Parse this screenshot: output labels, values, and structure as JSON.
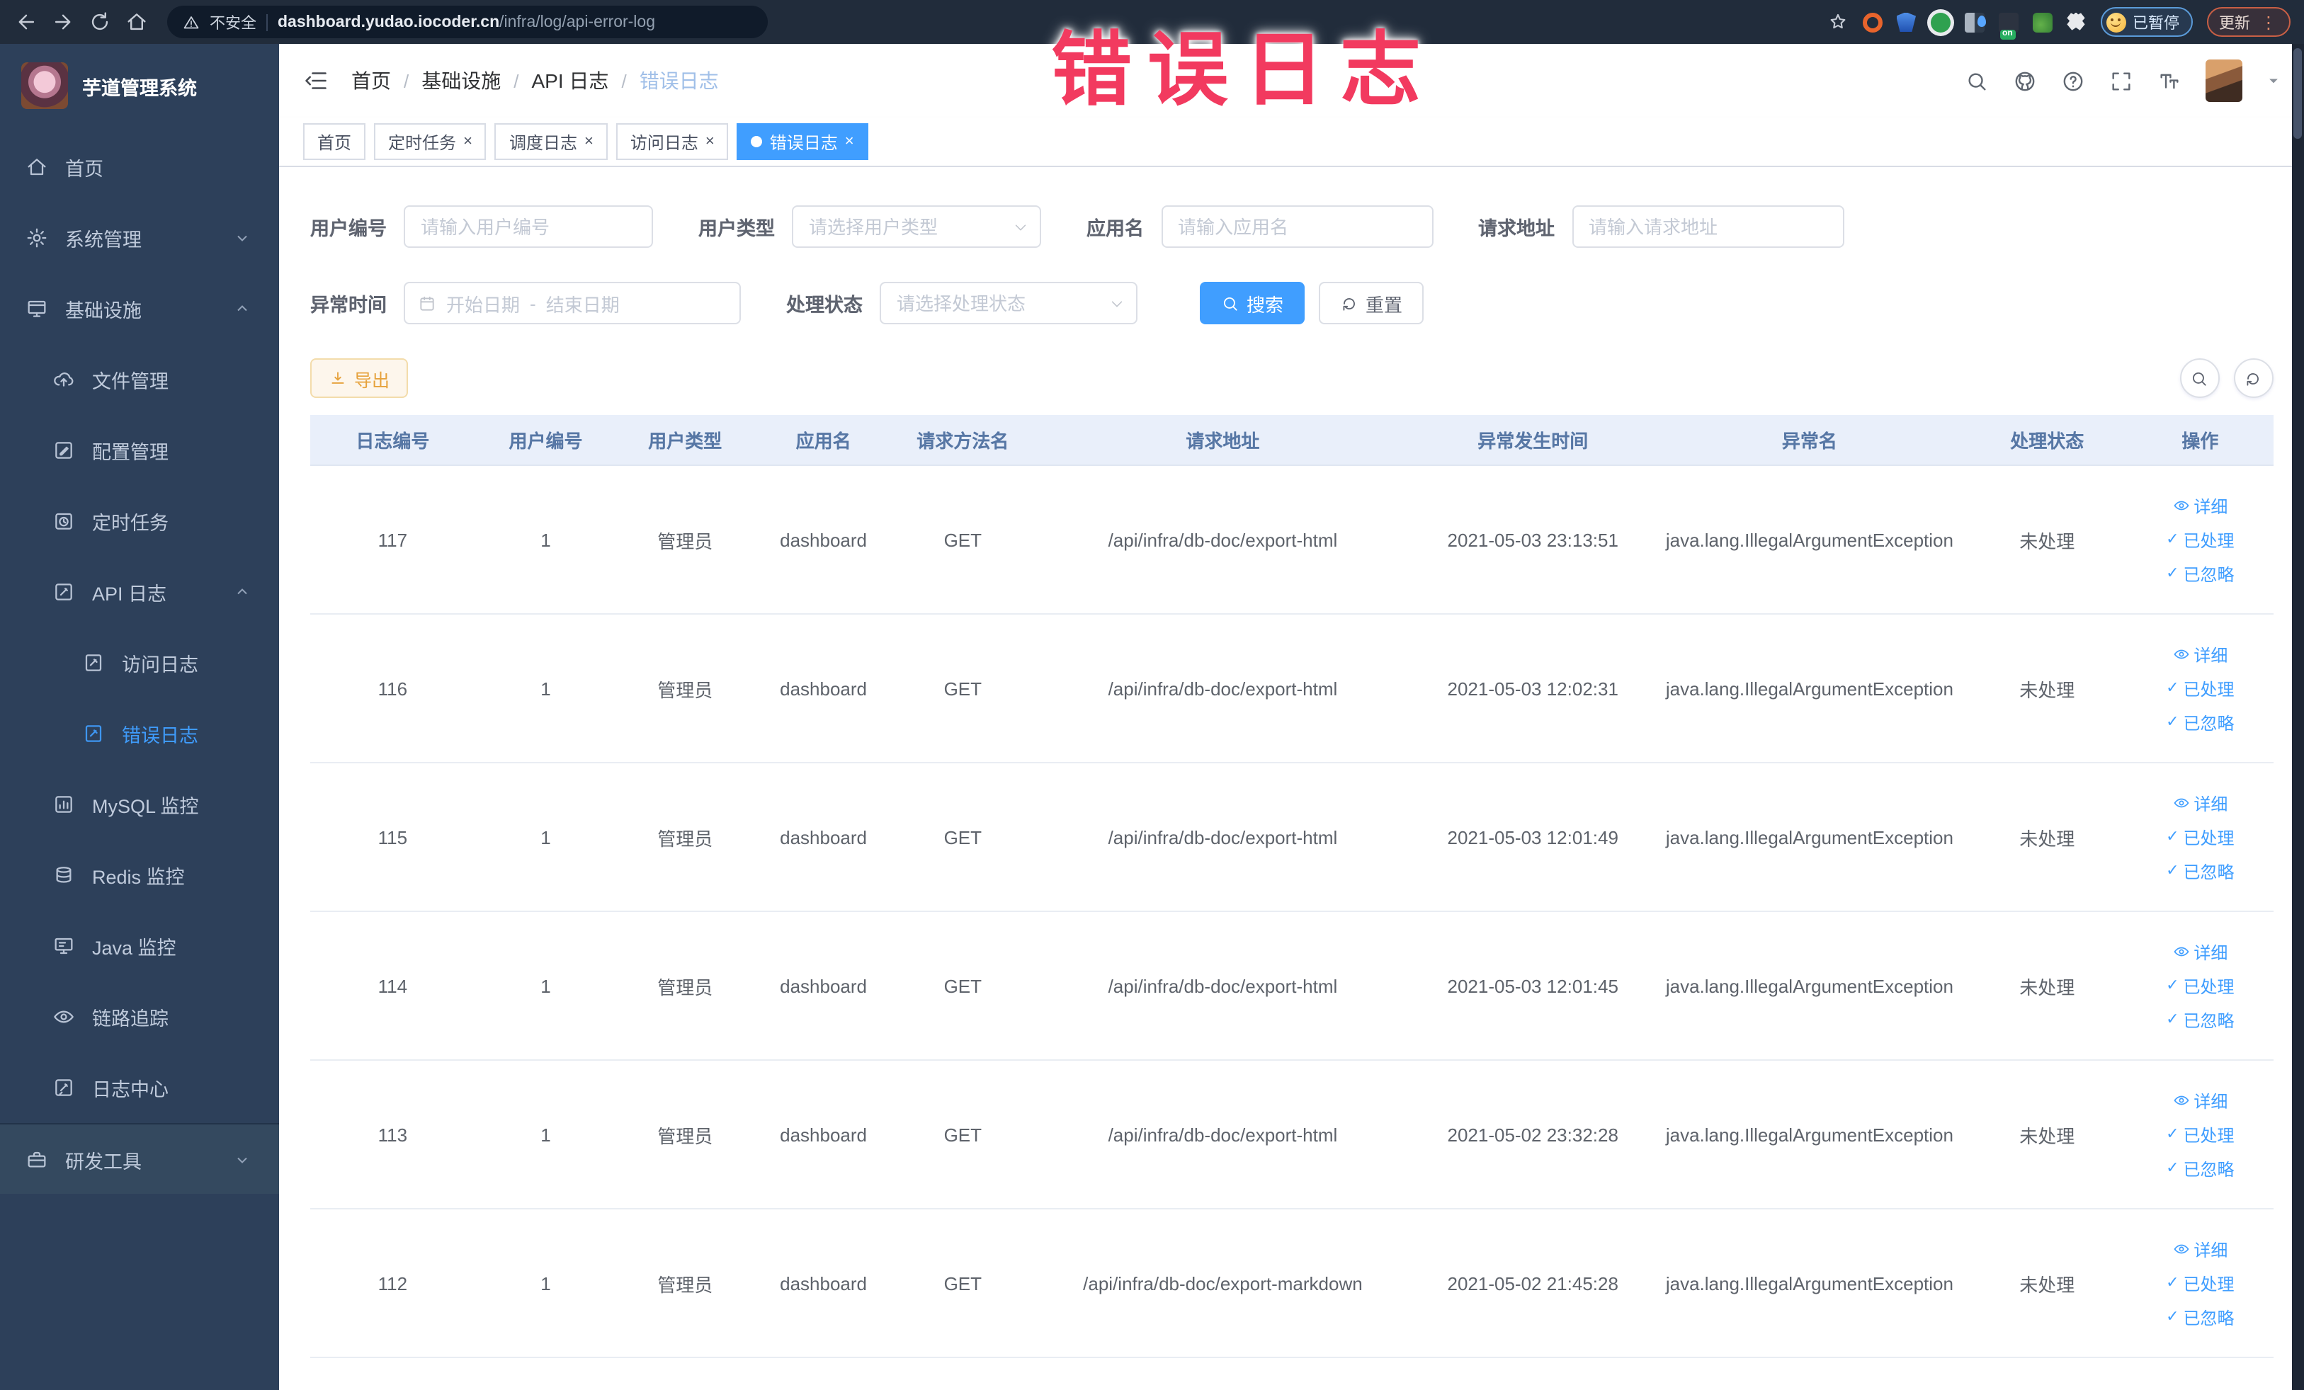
{
  "browser": {
    "security_label": "不安全",
    "url_host": "dashboard.yudao.iocoder.cn",
    "url_path": "/infra/log/api-error-log",
    "nav_icons": [
      "back-arrow",
      "forward-arrow",
      "reload",
      "home"
    ],
    "extension_icons": [
      "bookmark-star",
      "orange-ring-extension",
      "blue-shield-extension",
      "green-circle-extension",
      "grid-blue-extension",
      "on-badge-extension",
      "green-leaf-extension",
      "white-puzzle-extension"
    ],
    "paused_badge": "已暂停",
    "update_button": "更新",
    "menu_dots": "⋮"
  },
  "annotation": "错误日志",
  "sidebar": {
    "title": "芋道管理系统",
    "menu": [
      {
        "label": "首页",
        "icon": "home",
        "level": 0
      },
      {
        "label": "系统管理",
        "icon": "gear",
        "level": 0,
        "chevron": "down"
      },
      {
        "label": "基础设施",
        "icon": "infrastructure",
        "level": 0,
        "chevron": "up"
      },
      {
        "label": "文件管理",
        "icon": "file-upload",
        "level": 1
      },
      {
        "label": "配置管理",
        "icon": "config-edit",
        "level": 1
      },
      {
        "label": "定时任务",
        "icon": "scheduled-task",
        "level": 1
      },
      {
        "label": "API 日志",
        "icon": "api-log",
        "level": 1,
        "chevron": "up"
      },
      {
        "label": "访问日志",
        "icon": "access-log",
        "level": 2
      },
      {
        "label": "错误日志",
        "icon": "error-log",
        "level": 2,
        "active": true
      },
      {
        "label": "MySQL 监控",
        "icon": "mysql-monitor",
        "level": 1
      },
      {
        "label": "Redis 监控",
        "icon": "redis-monitor",
        "level": 1
      },
      {
        "label": "Java 监控",
        "icon": "java-monitor",
        "level": 1
      },
      {
        "label": "链路追踪",
        "icon": "trace",
        "level": 1
      },
      {
        "label": "日志中心",
        "icon": "log-center",
        "level": 1
      },
      {
        "label": "研发工具",
        "icon": "dev-tools",
        "level": 0,
        "chevron": "down",
        "section": true
      }
    ]
  },
  "header": {
    "breadcrumb": [
      "首页",
      "基础设施",
      "API 日志",
      "错误日志"
    ],
    "icons": [
      "search",
      "github",
      "help",
      "fullscreen",
      "font-size",
      "avatar",
      "caret-down"
    ]
  },
  "tabs": [
    {
      "label": "首页",
      "closable": false,
      "active": false
    },
    {
      "label": "定时任务",
      "closable": true,
      "active": false
    },
    {
      "label": "调度日志",
      "closable": true,
      "active": false
    },
    {
      "label": "访问日志",
      "closable": true,
      "active": false
    },
    {
      "label": "错误日志",
      "closable": true,
      "active": true
    }
  ],
  "filters": {
    "user_id": {
      "label": "用户编号",
      "placeholder": "请输入用户编号"
    },
    "user_type": {
      "label": "用户类型",
      "placeholder": "请选择用户类型"
    },
    "app_name": {
      "label": "应用名",
      "placeholder": "请输入应用名"
    },
    "request_url": {
      "label": "请求地址",
      "placeholder": "请输入请求地址"
    },
    "exception_time": {
      "label": "异常时间",
      "start_placeholder": "开始日期",
      "range_separator": "-",
      "end_placeholder": "结束日期"
    },
    "process_status": {
      "label": "处理状态",
      "placeholder": "请选择处理状态"
    },
    "search_label": "搜索",
    "reset_label": "重置"
  },
  "toolbar": {
    "export_label": "导出"
  },
  "table": {
    "headers": [
      "日志编号",
      "用户编号",
      "用户类型",
      "应用名",
      "请求方法名",
      "请求地址",
      "异常发生时间",
      "异常名",
      "处理状态",
      "操作"
    ],
    "actions": {
      "detail": "详细",
      "processed": "已处理",
      "ignored": "已忽略"
    },
    "rows": [
      {
        "id": "117",
        "user_id": "1",
        "user_type": "管理员",
        "app": "dashboard",
        "method": "GET",
        "url": "/api/infra/db-doc/export-html",
        "time": "2021-05-03 23:13:51",
        "exception": "java.lang.IllegalArgumentException",
        "status": "未处理"
      },
      {
        "id": "116",
        "user_id": "1",
        "user_type": "管理员",
        "app": "dashboard",
        "method": "GET",
        "url": "/api/infra/db-doc/export-html",
        "time": "2021-05-03 12:02:31",
        "exception": "java.lang.IllegalArgumentException",
        "status": "未处理"
      },
      {
        "id": "115",
        "user_id": "1",
        "user_type": "管理员",
        "app": "dashboard",
        "method": "GET",
        "url": "/api/infra/db-doc/export-html",
        "time": "2021-05-03 12:01:49",
        "exception": "java.lang.IllegalArgumentException",
        "status": "未处理"
      },
      {
        "id": "114",
        "user_id": "1",
        "user_type": "管理员",
        "app": "dashboard",
        "method": "GET",
        "url": "/api/infra/db-doc/export-html",
        "time": "2021-05-03 12:01:45",
        "exception": "java.lang.IllegalArgumentException",
        "status": "未处理"
      },
      {
        "id": "113",
        "user_id": "1",
        "user_type": "管理员",
        "app": "dashboard",
        "method": "GET",
        "url": "/api/infra/db-doc/export-html",
        "time": "2021-05-02 23:32:28",
        "exception": "java.lang.IllegalArgumentException",
        "status": "未处理"
      },
      {
        "id": "112",
        "user_id": "1",
        "user_type": "管理员",
        "app": "dashboard",
        "method": "GET",
        "url": "/api/infra/db-doc/export-markdown",
        "time": "2021-05-02 21:45:28",
        "exception": "java.lang.IllegalArgumentException",
        "status": "未处理"
      }
    ]
  }
}
